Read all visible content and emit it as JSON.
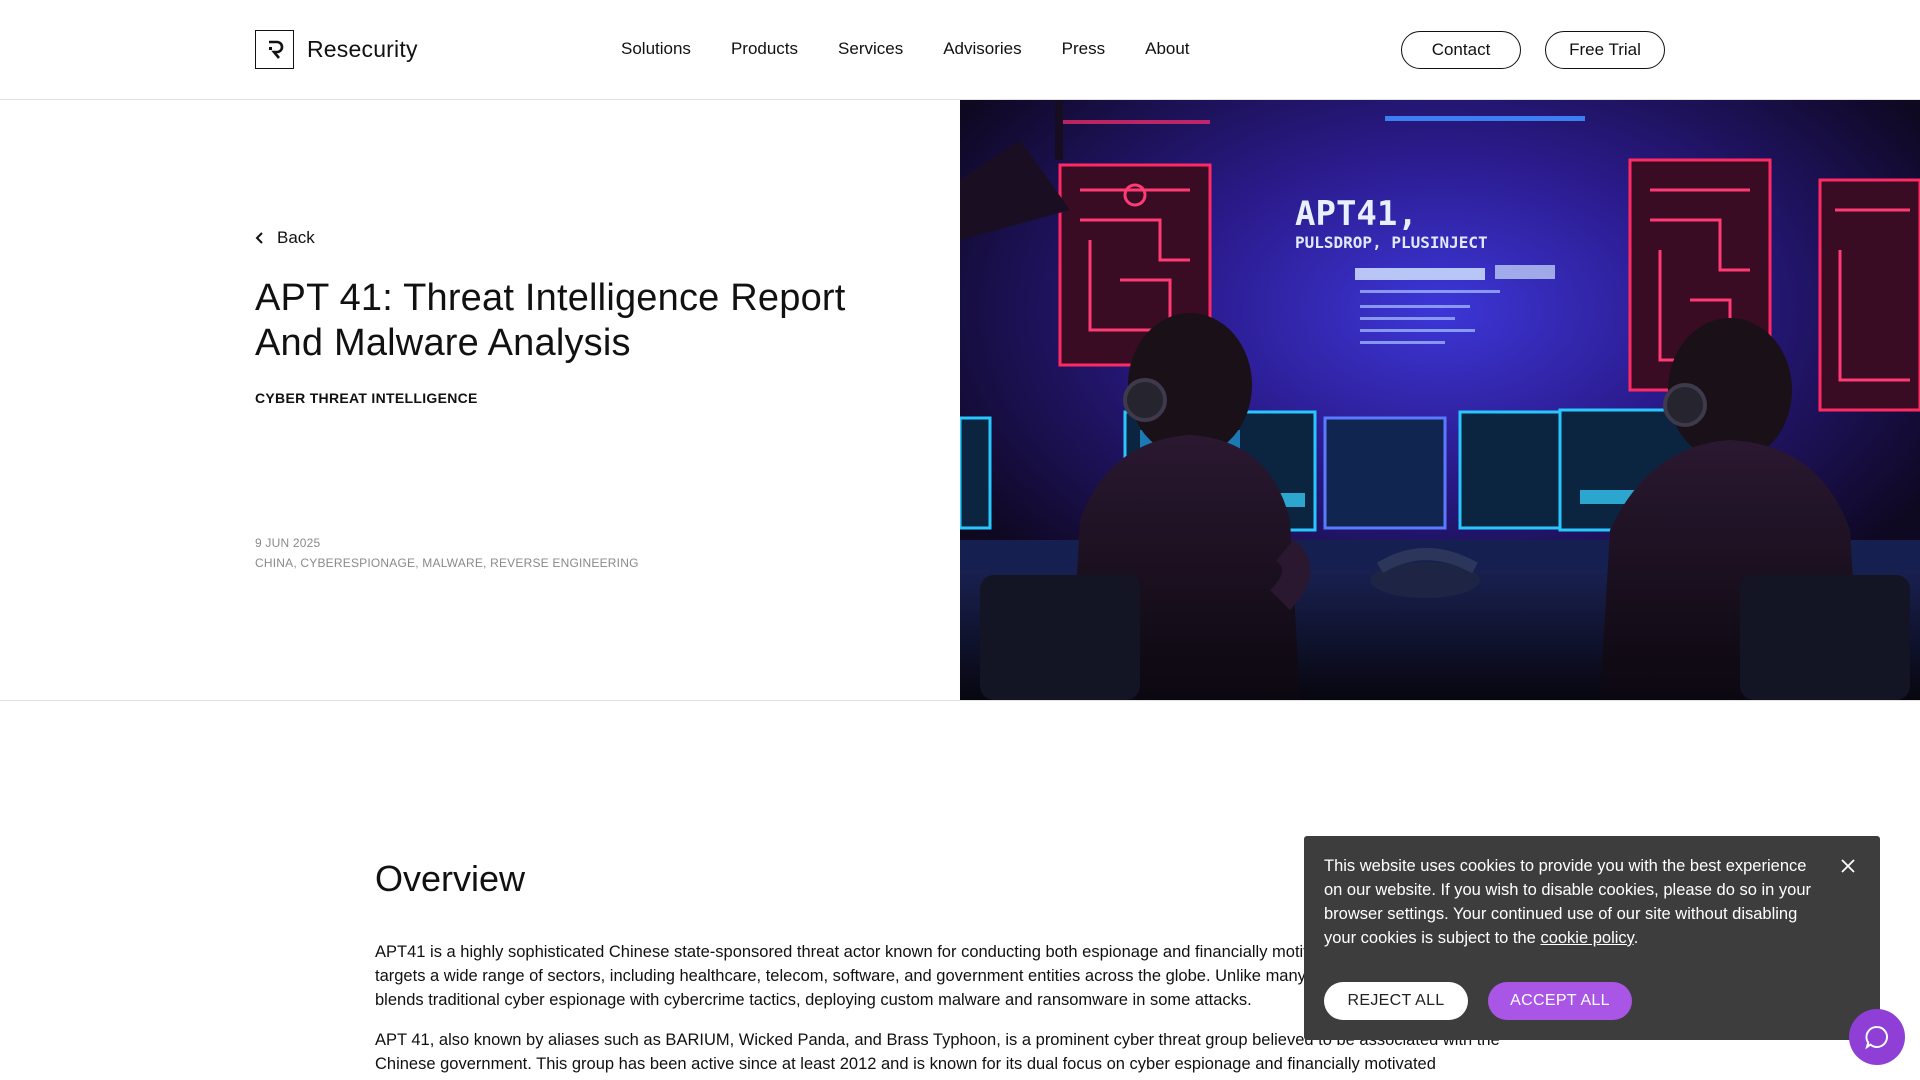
{
  "header": {
    "brand": "Resecurity",
    "nav": [
      "Solutions",
      "Products",
      "Services",
      "Advisories",
      "Press",
      "About"
    ],
    "contact_label": "Contact",
    "trial_label": "Free Trial"
  },
  "hero": {
    "back_label": "Back",
    "title": "APT 41: Threat Intelligence Report And Malware Analysis",
    "category": "CYBER THREAT INTELLIGENCE",
    "date": "9 JUN 2025",
    "tags": "CHINA, CYBERESPIONAGE, MALWARE, REVERSE ENGINEERING",
    "image": {
      "headline": "APT41,",
      "subline": "PULSDROP, PLUSINJECT"
    }
  },
  "article": {
    "heading": "Overview",
    "paragraphs": [
      "APT41 is a highly sophisticated Chinese state-sponsored threat actor known for conducting both espionage and financially motivated cyberattacks. This group targets a wide range of sectors, including healthcare, telecom, software, and government entities across the globe. Unlike many threat groups, APT41 uniquely blends traditional cyber espionage with cybercrime tactics, deploying custom malware and ransomware in some attacks.",
      "APT 41, also known by aliases such as BARIUM, Wicked Panda, and Brass Typhoon, is a prominent cyber threat group believed to be associated with the Chinese government. This group has been active since at least 2012 and is known for its dual focus on cyber espionage and financially motivated"
    ]
  },
  "cookie": {
    "text": "This website uses cookies to provide you with the best experience on our website. If you wish to disable cookies, please do so in your browser settings. Your continued use of our site without disabling your cookies is subject to the ",
    "link_label": "cookie policy",
    "text_end": ".",
    "reject_label": "REJECT ALL",
    "accept_label": "ACCEPT ALL"
  },
  "colors": {
    "accent": "#a956e6",
    "chat": "#8f3fd6",
    "cookie_bg": "#3d3d3d",
    "muted": "#8a8a8a"
  }
}
